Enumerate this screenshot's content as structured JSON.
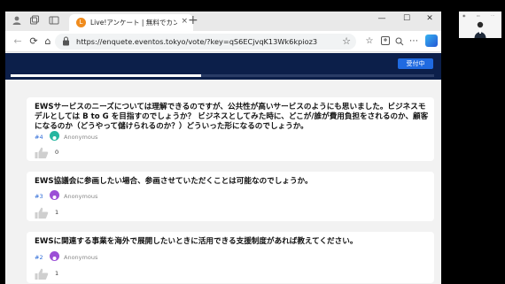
{
  "browser": {
    "tab": {
      "title": "Live!アンケート | 無料でカンタン！リア",
      "close": "×",
      "favicon_color": "#f08c1e"
    },
    "new_tab_label": "+",
    "window_controls": [
      "—",
      "☐",
      "✕"
    ],
    "nav": {
      "back": "←",
      "reload": "⟳",
      "home": "⌂"
    },
    "url": "https://enquete.eventos.tokyo/vote/?key=qS6ECjvqK13Wk6kpioz3"
  },
  "page": {
    "status_button": "受付中",
    "header_color": "#0c1f4a",
    "accent_color": "#1f6ae0",
    "progress": 0.45,
    "questions": [
      {
        "text": "EWSサービスのニーズについては理解できるのですが、公共性が高いサービスのようにも思いました。ビジネスモデルとしては B to G を目指すのでしょうか？ ビジネスとしてみた時に、どこが/誰が費用負担をされるのか、顧客になるのか（どうやって儲けられるのか？）どういった形になるのでしょうか。",
        "number": "#4",
        "author": "Anonymous",
        "likes": "0",
        "avatar_color": "#26b6a0"
      },
      {
        "text": "EWS協議会に参画したい場合、参画させていただくことは可能なのでしょうか。",
        "number": "#3",
        "author": "Anonymous",
        "likes": "1",
        "avatar_color": "#9b4fd6"
      },
      {
        "text": "EWSに関連する事業を海外で展開したいときに活用できる支援制度があれば教えてください。",
        "number": "#2",
        "author": "Anonymous",
        "likes": "1",
        "avatar_color": "#9b4fd6"
      }
    ]
  }
}
